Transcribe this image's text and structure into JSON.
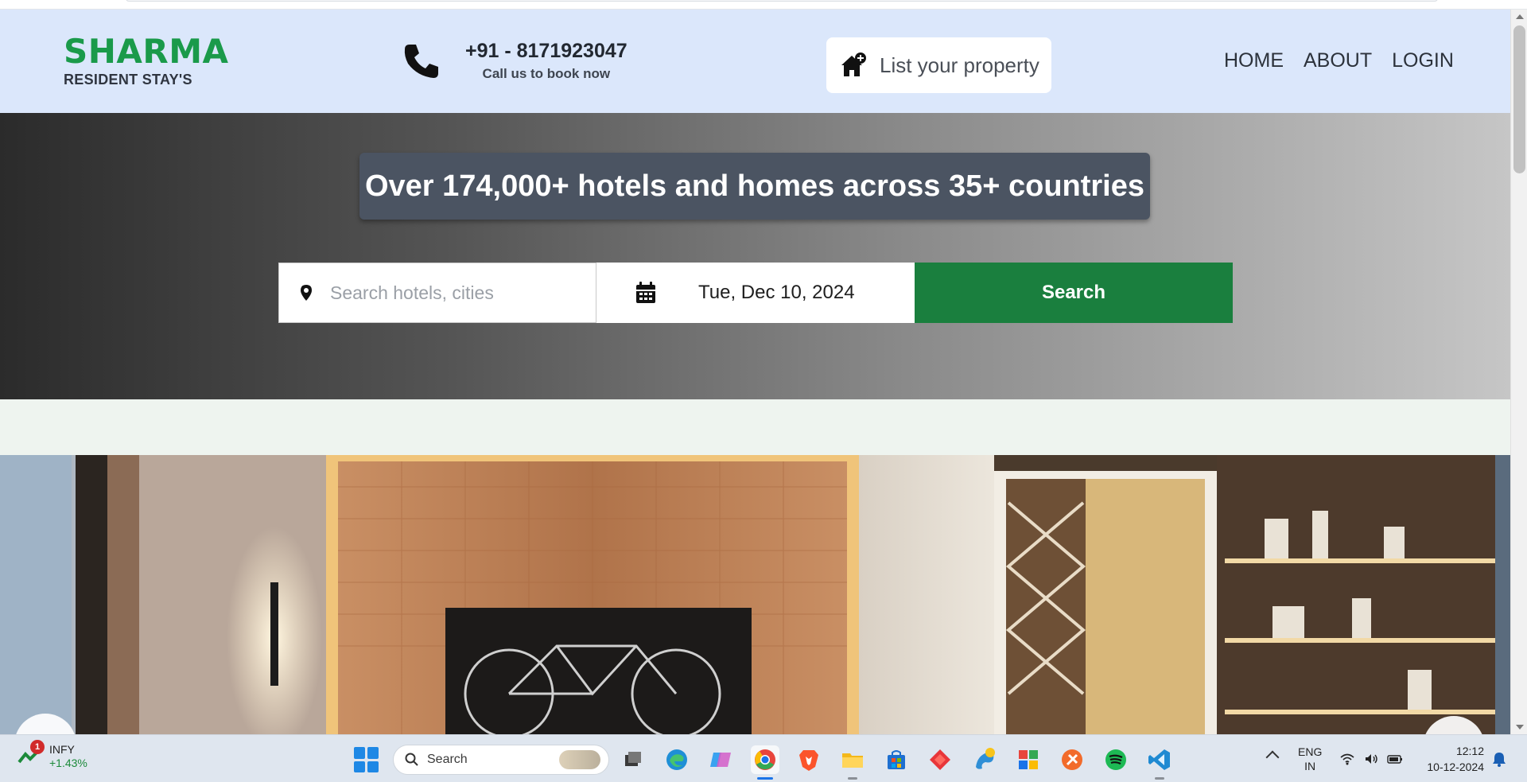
{
  "header": {
    "brand_name": "SHARMA",
    "brand_sub": "RESIDENT STAY'S",
    "phone_number": "+91 - 8171923047",
    "phone_sub": "Call us to book now",
    "list_property_label": "List your property",
    "nav": [
      "HOME",
      "ABOUT",
      "LOGIN"
    ]
  },
  "hero": {
    "title": "Over 174,000+ hotels and homes across 35+ countries",
    "search_placeholder": "Search hotels, cities",
    "search_value": "",
    "date_value": "Tue, Dec 10, 2024",
    "search_button": "Search"
  },
  "slider": {
    "icons": {
      "prev": "chevron-left-icon",
      "next": "chevron-right-icon"
    }
  },
  "taskbar": {
    "stock": {
      "badge": "1",
      "name": "INFY",
      "change": "+1.43%"
    },
    "search_label": "Search",
    "apps": [
      "task-view",
      "edge",
      "copilot",
      "chrome",
      "brave",
      "file-explorer",
      "microsoft-store",
      "app-red-diamond",
      "paint-app",
      "app-grid",
      "app-orange",
      "spotify",
      "vscode"
    ],
    "language_1": "ENG",
    "language_2": "IN",
    "time": "12:12",
    "date": "10-12-2024"
  },
  "colors": {
    "brand_green": "#1a9a4a",
    "header_bg": "#dbe7fb",
    "search_button_bg": "#1a7f3e",
    "hero_title_bg": "#4b5462"
  }
}
